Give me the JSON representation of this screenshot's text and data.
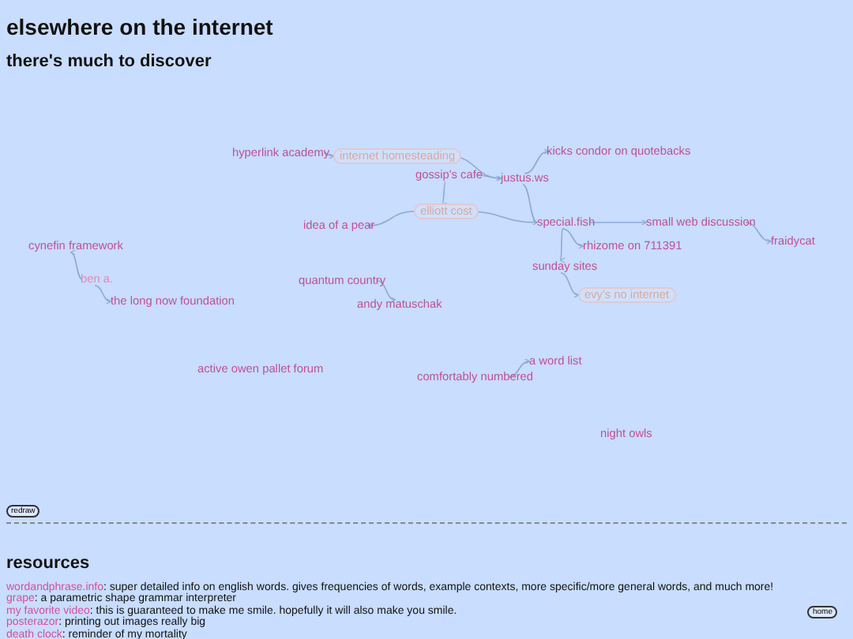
{
  "title": "elsewhere on the internet",
  "subtitle": "there's much to discover",
  "graph": {
    "nodes": [
      {
        "label": "hyperlink academy",
        "kind": "link"
      },
      {
        "label": "internet homesteading",
        "kind": "tag"
      },
      {
        "label": "gossip's cafe",
        "kind": "link"
      },
      {
        "label": "justus.ws",
        "kind": "link"
      },
      {
        "label": "kicks condor on quotebacks",
        "kind": "link"
      },
      {
        "label": "elliott cost",
        "kind": "tag"
      },
      {
        "label": "idea of a pear",
        "kind": "link"
      },
      {
        "label": "special.fish",
        "kind": "link"
      },
      {
        "label": "small web discussion",
        "kind": "link"
      },
      {
        "label": "rhizome on 711391",
        "kind": "link"
      },
      {
        "label": "fraidycat",
        "kind": "link"
      },
      {
        "label": "sunday sites",
        "kind": "link"
      },
      {
        "label": "evy's no internet",
        "kind": "tag"
      },
      {
        "label": "cynefin framework",
        "kind": "link"
      },
      {
        "label": "ben a.",
        "kind": "muted"
      },
      {
        "label": "the long now foundation",
        "kind": "link"
      },
      {
        "label": "quantum country",
        "kind": "link"
      },
      {
        "label": "andy matuschak",
        "kind": "link"
      },
      {
        "label": "active owen pallet forum",
        "kind": "link"
      },
      {
        "label": "comfortably numbered",
        "kind": "link"
      },
      {
        "label": "a word list",
        "kind": "link"
      },
      {
        "label": "night owls",
        "kind": "link"
      }
    ],
    "redraw_button": "redraw"
  },
  "resources": {
    "heading": "resources",
    "items": [
      {
        "link": "wordandphrase.info",
        "text": ": super detailed info on english words. gives frequencies of words, example contexts, more specific/more general words, and much more!"
      },
      {
        "link": "grape",
        "text": ": a parametric shape grammar interpreter"
      },
      {
        "link": "my favorite video",
        "text": ": this is guaranteed to make me smile. hopefully it will also make you smile."
      },
      {
        "link": "posterazor",
        "text": ": printing out images really big"
      },
      {
        "link": "death clock",
        "text": ": reminder of my mortality"
      }
    ],
    "home_button": "home"
  }
}
